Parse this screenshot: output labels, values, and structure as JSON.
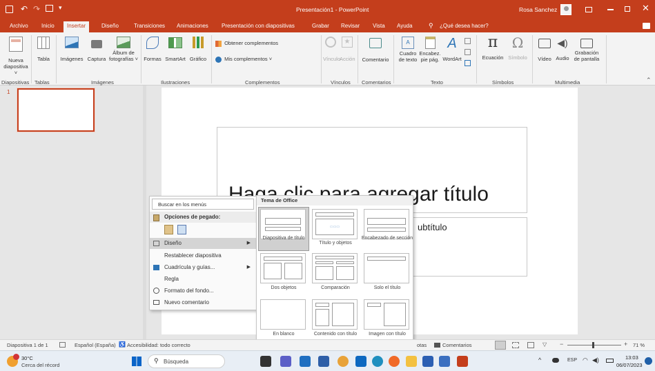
{
  "titlebar": {
    "document_title": "Presentación1 - PowerPoint",
    "user_name": "Rosa Sanchez",
    "quick_access": [
      "save",
      "undo",
      "redo",
      "present"
    ]
  },
  "tabs": [
    "Archivo",
    "Inicio",
    "Insertar",
    "Diseño",
    "Transiciones",
    "Animaciones",
    "Presentación con diapositivas",
    "Grabar",
    "Revisar",
    "Vista",
    "Ayuda"
  ],
  "tell_me": "¿Qué desea hacer?",
  "ribbon": {
    "nueva_diapositiva": "Nueva\ndiapositiva ˅",
    "tabla": "Tabla",
    "imagenes": "Imágenes",
    "captura": "Captura",
    "album": "Álbum de\nfotografías ˅",
    "formas": "Formas",
    "smartart": "SmartArt",
    "grafico": "Gráfico",
    "obtener_complementos": "Obtener complementos",
    "mis_complementos": "Mis complementos",
    "vinculo": "Vínculo",
    "accion": "Acción",
    "comentario": "Comentario",
    "cuadro_texto": "Cuadro\nde texto",
    "encabez": "Encabez.\npie pág.",
    "wordart": "WordArt",
    "ecuacion": "Ecuación",
    "simbolo": "Símbolo",
    "video": "Vídeo",
    "audio": "Audio",
    "grabacion": "Grabación\nde pantalla",
    "groups": {
      "diapositivas": "Diapositivas",
      "tablas": "Tablas",
      "imagenes": "Imágenes",
      "ilustraciones": "Ilustraciones",
      "complementos": "Complementos",
      "vinculos": "Vínculos",
      "comentarios": "Comentarios",
      "texto": "Texto",
      "simbolos": "Símbolos",
      "multimedia": "Multimedia"
    }
  },
  "thumbnail": {
    "number": "1"
  },
  "slide": {
    "title_placeholder": "Haga clic para agregar título",
    "subtitle_placeholder": "ubtítulo"
  },
  "context_menu": {
    "search": "Buscar en los menús",
    "paste_options": "Opciones de pegado:",
    "items": [
      "Diseño",
      "Restablecer diapositiva",
      "Cuadrícula y guías...",
      "Regla",
      "Formato del fondo...",
      "Nuevo comentario"
    ]
  },
  "layout_gallery": {
    "header": "Tema de Office",
    "layouts": [
      "Diapositiva de título",
      "Título y objetos",
      "Encabezado de sección",
      "Dos objetos",
      "Comparación",
      "Solo el título",
      "En blanco",
      "Contenido con título",
      "Imagen con título"
    ]
  },
  "statusbar": {
    "slide_info": "Diapositiva 1 de 1",
    "language": "Español (España)",
    "accessibility": "Accesibilidad: todo correcto",
    "notes": "otas",
    "comments": "Comentarios",
    "zoom": "71 %"
  },
  "taskbar": {
    "weather_temp": "30°C",
    "weather_desc": "Cerca del récord",
    "search": "Búsqueda",
    "lang": "ESP",
    "time": "13:03",
    "date": "06/07/2023"
  },
  "colors": {
    "accent": "#c43e1c",
    "ribbon": "#f3f3f3",
    "selection": "#d0d0d0"
  }
}
